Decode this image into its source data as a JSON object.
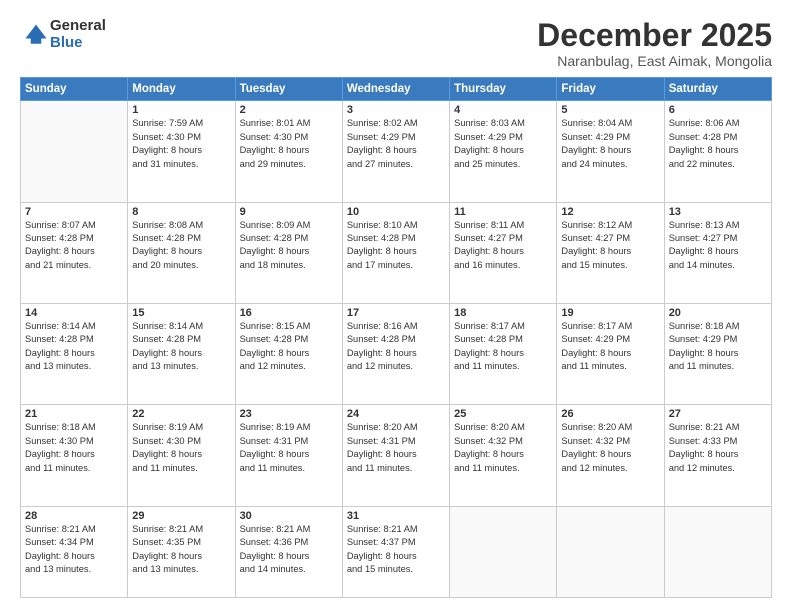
{
  "logo": {
    "general": "General",
    "blue": "Blue"
  },
  "header": {
    "month": "December 2025",
    "location": "Naranbulag, East Aimak, Mongolia"
  },
  "days_of_week": [
    "Sunday",
    "Monday",
    "Tuesday",
    "Wednesday",
    "Thursday",
    "Friday",
    "Saturday"
  ],
  "weeks": [
    [
      {
        "day": "",
        "info": ""
      },
      {
        "day": "1",
        "info": "Sunrise: 7:59 AM\nSunset: 4:30 PM\nDaylight: 8 hours\nand 31 minutes."
      },
      {
        "day": "2",
        "info": "Sunrise: 8:01 AM\nSunset: 4:30 PM\nDaylight: 8 hours\nand 29 minutes."
      },
      {
        "day": "3",
        "info": "Sunrise: 8:02 AM\nSunset: 4:29 PM\nDaylight: 8 hours\nand 27 minutes."
      },
      {
        "day": "4",
        "info": "Sunrise: 8:03 AM\nSunset: 4:29 PM\nDaylight: 8 hours\nand 25 minutes."
      },
      {
        "day": "5",
        "info": "Sunrise: 8:04 AM\nSunset: 4:29 PM\nDaylight: 8 hours\nand 24 minutes."
      },
      {
        "day": "6",
        "info": "Sunrise: 8:06 AM\nSunset: 4:28 PM\nDaylight: 8 hours\nand 22 minutes."
      }
    ],
    [
      {
        "day": "7",
        "info": "Sunrise: 8:07 AM\nSunset: 4:28 PM\nDaylight: 8 hours\nand 21 minutes."
      },
      {
        "day": "8",
        "info": "Sunrise: 8:08 AM\nSunset: 4:28 PM\nDaylight: 8 hours\nand 20 minutes."
      },
      {
        "day": "9",
        "info": "Sunrise: 8:09 AM\nSunset: 4:28 PM\nDaylight: 8 hours\nand 18 minutes."
      },
      {
        "day": "10",
        "info": "Sunrise: 8:10 AM\nSunset: 4:28 PM\nDaylight: 8 hours\nand 17 minutes."
      },
      {
        "day": "11",
        "info": "Sunrise: 8:11 AM\nSunset: 4:27 PM\nDaylight: 8 hours\nand 16 minutes."
      },
      {
        "day": "12",
        "info": "Sunrise: 8:12 AM\nSunset: 4:27 PM\nDaylight: 8 hours\nand 15 minutes."
      },
      {
        "day": "13",
        "info": "Sunrise: 8:13 AM\nSunset: 4:27 PM\nDaylight: 8 hours\nand 14 minutes."
      }
    ],
    [
      {
        "day": "14",
        "info": "Sunrise: 8:14 AM\nSunset: 4:28 PM\nDaylight: 8 hours\nand 13 minutes."
      },
      {
        "day": "15",
        "info": "Sunrise: 8:14 AM\nSunset: 4:28 PM\nDaylight: 8 hours\nand 13 minutes."
      },
      {
        "day": "16",
        "info": "Sunrise: 8:15 AM\nSunset: 4:28 PM\nDaylight: 8 hours\nand 12 minutes."
      },
      {
        "day": "17",
        "info": "Sunrise: 8:16 AM\nSunset: 4:28 PM\nDaylight: 8 hours\nand 12 minutes."
      },
      {
        "day": "18",
        "info": "Sunrise: 8:17 AM\nSunset: 4:28 PM\nDaylight: 8 hours\nand 11 minutes."
      },
      {
        "day": "19",
        "info": "Sunrise: 8:17 AM\nSunset: 4:29 PM\nDaylight: 8 hours\nand 11 minutes."
      },
      {
        "day": "20",
        "info": "Sunrise: 8:18 AM\nSunset: 4:29 PM\nDaylight: 8 hours\nand 11 minutes."
      }
    ],
    [
      {
        "day": "21",
        "info": "Sunrise: 8:18 AM\nSunset: 4:30 PM\nDaylight: 8 hours\nand 11 minutes."
      },
      {
        "day": "22",
        "info": "Sunrise: 8:19 AM\nSunset: 4:30 PM\nDaylight: 8 hours\nand 11 minutes."
      },
      {
        "day": "23",
        "info": "Sunrise: 8:19 AM\nSunset: 4:31 PM\nDaylight: 8 hours\nand 11 minutes."
      },
      {
        "day": "24",
        "info": "Sunrise: 8:20 AM\nSunset: 4:31 PM\nDaylight: 8 hours\nand 11 minutes."
      },
      {
        "day": "25",
        "info": "Sunrise: 8:20 AM\nSunset: 4:32 PM\nDaylight: 8 hours\nand 11 minutes."
      },
      {
        "day": "26",
        "info": "Sunrise: 8:20 AM\nSunset: 4:32 PM\nDaylight: 8 hours\nand 12 minutes."
      },
      {
        "day": "27",
        "info": "Sunrise: 8:21 AM\nSunset: 4:33 PM\nDaylight: 8 hours\nand 12 minutes."
      }
    ],
    [
      {
        "day": "28",
        "info": "Sunrise: 8:21 AM\nSunset: 4:34 PM\nDaylight: 8 hours\nand 13 minutes."
      },
      {
        "day": "29",
        "info": "Sunrise: 8:21 AM\nSunset: 4:35 PM\nDaylight: 8 hours\nand 13 minutes."
      },
      {
        "day": "30",
        "info": "Sunrise: 8:21 AM\nSunset: 4:36 PM\nDaylight: 8 hours\nand 14 minutes."
      },
      {
        "day": "31",
        "info": "Sunrise: 8:21 AM\nSunset: 4:37 PM\nDaylight: 8 hours\nand 15 minutes."
      },
      {
        "day": "",
        "info": ""
      },
      {
        "day": "",
        "info": ""
      },
      {
        "day": "",
        "info": ""
      }
    ]
  ]
}
